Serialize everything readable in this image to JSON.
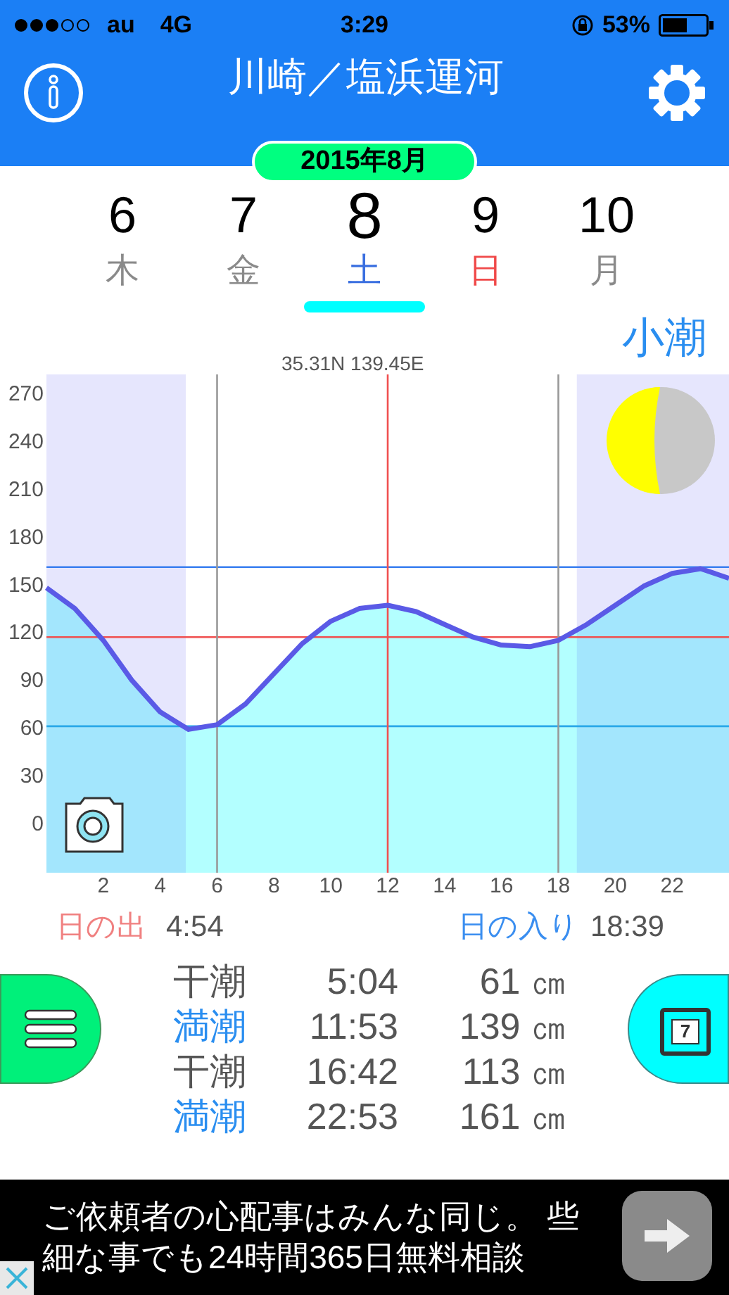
{
  "status_bar": {
    "carrier": "au",
    "network": "4G",
    "time": "3:29",
    "battery": "53%"
  },
  "header": {
    "title": "川崎／塩浜運河",
    "month": "2015年8月"
  },
  "days": [
    {
      "day": "6",
      "weekday": "木",
      "color": "#8a8a8a",
      "selected": false
    },
    {
      "day": "7",
      "weekday": "金",
      "color": "#8a8a8a",
      "selected": false
    },
    {
      "day": "8",
      "weekday": "土",
      "color": "#3a6fe0",
      "selected": true
    },
    {
      "day": "9",
      "weekday": "日",
      "color": "#f04a4a",
      "selected": false
    },
    {
      "day": "10",
      "weekday": "月",
      "color": "#8a8a8a",
      "selected": false
    }
  ],
  "tide_type": "小潮",
  "coordinates": "35.31N 139.45E",
  "chart_data": {
    "type": "area",
    "x": [
      0,
      1,
      2,
      3,
      4,
      5,
      6,
      7,
      8,
      9,
      10,
      11,
      12,
      13,
      14,
      15,
      16,
      17,
      18,
      19,
      20,
      21,
      22,
      23,
      24
    ],
    "values": [
      148,
      135,
      115,
      90,
      70,
      59,
      62,
      75,
      94,
      113,
      127,
      135,
      137,
      133,
      125,
      117,
      112,
      111,
      115,
      125,
      137,
      149,
      157,
      160,
      154
    ],
    "color": "#5a5ae6",
    "xlim": [
      0,
      24
    ],
    "ylim": [
      -31,
      282
    ],
    "xticks": [
      2,
      4,
      6,
      8,
      10,
      12,
      14,
      16,
      18,
      20,
      22
    ],
    "yticks": [
      0,
      30,
      60,
      90,
      120,
      150,
      180,
      210,
      240,
      270
    ],
    "bands": [
      {
        "axis": "x",
        "from": 0,
        "to": 4.9
      },
      {
        "axis": "x",
        "from": 18.65,
        "to": 24
      }
    ],
    "ref_lines": [
      {
        "axis": "y",
        "value": 161,
        "color": "#3a7ff0"
      },
      {
        "axis": "y",
        "value": 61,
        "color": "#2aa8e8"
      },
      {
        "axis": "y",
        "value": 117,
        "color": "#f05050"
      },
      {
        "axis": "x",
        "value": 6,
        "color": "#999999"
      },
      {
        "axis": "x",
        "value": 12,
        "color": "#f05050"
      },
      {
        "axis": "x",
        "value": 18,
        "color": "#999999"
      }
    ]
  },
  "sun": {
    "sunrise_label": "日の出",
    "sunrise": "4:54",
    "sunset_label": "日の入り",
    "sunset": "18:39"
  },
  "tides": [
    {
      "kind": "low",
      "label": "干潮",
      "time": "5:04",
      "height": "61 ㎝"
    },
    {
      "kind": "high",
      "label": "満潮",
      "time": "11:53",
      "height": "139 ㎝"
    },
    {
      "kind": "low",
      "label": "干潮",
      "time": "16:42",
      "height": "113 ㎝"
    },
    {
      "kind": "high",
      "label": "満潮",
      "time": "22:53",
      "height": "161 ㎝"
    }
  ],
  "calendar_button": {
    "day": "7"
  },
  "ad": {
    "lines": [
      "ご依頼者の心配事はみんな同じ。 些",
      "細な事でも24時間365日無料相談"
    ]
  }
}
